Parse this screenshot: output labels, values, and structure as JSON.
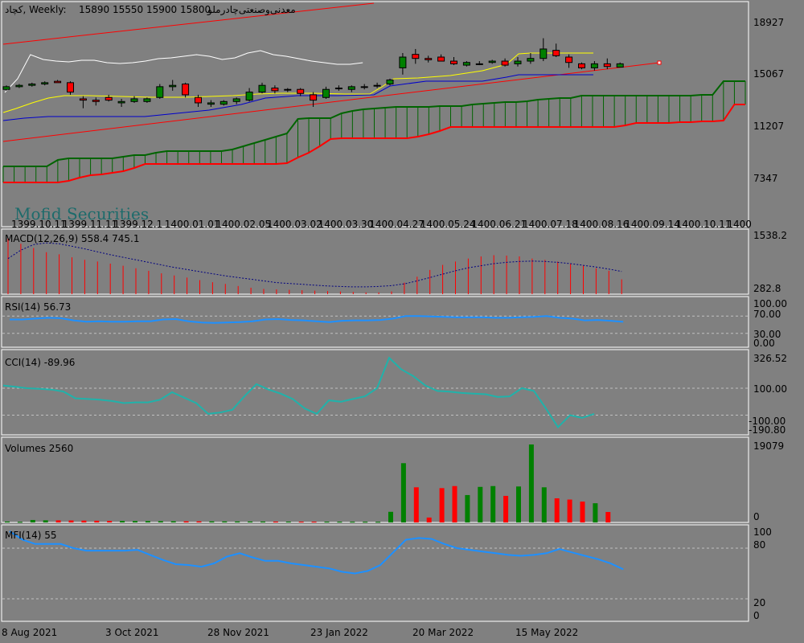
{
  "header": {
    "symbol": "کچاد, Weekly:",
    "ohlc": "15890 15550 15900 15800",
    "name": "معدنی‌وصنعتی‌چادرملو"
  },
  "watermark": "Mofid Securities",
  "colors": {
    "background": "#808080",
    "bull": "#008000",
    "bear": "#ff0000",
    "ichimoku_cloud": "#006400",
    "ichimoku_base": "#ff0000",
    "channel": "#ff0000",
    "chikou": "#ffffff",
    "tenkan": "#ffff00",
    "kijun": "#0000cc",
    "macd_hist": "#ff0000",
    "macd_signal": "#000080",
    "rsi": "#1e90ff",
    "cci": "#20b2aa",
    "mfi": "#1e90ff"
  },
  "main_axis": {
    "ticks": [
      "18927",
      "15067",
      "11207",
      "7347"
    ]
  },
  "date_ticks_top": [
    "1399.10.11",
    "1399.11.11",
    "1399.12.1",
    "1400.01.01",
    "1400.02.05",
    "1400.03.02",
    "1400.03.30",
    "1400.04.27",
    "1400.05.24",
    "1400.06.21",
    "1400.07.18",
    "1400.08.16",
    "1400.09.14",
    "1400.10.11",
    "1400"
  ],
  "bottom_dates": [
    "8 Aug 2021",
    "3 Oct 2021",
    "28 Nov 2021",
    "23 Jan 2022",
    "20 Mar 2022",
    "15 May 2022"
  ],
  "macd": {
    "title": "MACD(12,26,9) 558.4 745.1",
    "ticks": [
      "1538.2",
      "282.8"
    ]
  },
  "rsi": {
    "title": "RSI(14) 56.73",
    "ticks": [
      "100.00",
      "70.00",
      "30.00",
      "0.00"
    ]
  },
  "cci": {
    "title": "CCI(14) -89.96",
    "ticks": [
      "326.52",
      "100.00",
      "-100.00",
      "-190.80"
    ]
  },
  "volumes": {
    "title": "Volumes 2560",
    "ticks": [
      "19079",
      "0"
    ]
  },
  "mfi": {
    "title": "MFI(14) 55",
    "ticks": [
      "100",
      "80",
      "20",
      "0"
    ]
  },
  "chart_data": {
    "type": "candlestick",
    "candles": [
      [
        13900,
        14200,
        13800,
        14100
      ],
      [
        14100,
        14300,
        14000,
        14200
      ],
      [
        14200,
        14400,
        14100,
        14300
      ],
      [
        14300,
        14500,
        14200,
        14400
      ],
      [
        14500,
        14600,
        14400,
        14400
      ],
      [
        14400,
        14500,
        13500,
        13700
      ],
      [
        13200,
        13400,
        12500,
        13100
      ],
      [
        13100,
        13300,
        12700,
        13000
      ],
      [
        13300,
        13500,
        13000,
        13100
      ],
      [
        12900,
        13200,
        12600,
        13000
      ],
      [
        13000,
        13400,
        12900,
        13200
      ],
      [
        13000,
        13300,
        12900,
        13200
      ],
      [
        13300,
        14300,
        13200,
        14100
      ],
      [
        14100,
        14600,
        13800,
        14200
      ],
      [
        14300,
        14400,
        13300,
        13500
      ],
      [
        13300,
        13500,
        12600,
        12900
      ],
      [
        12800,
        13100,
        12600,
        12900
      ],
      [
        12800,
        13100,
        12700,
        13000
      ],
      [
        13000,
        13300,
        12800,
        13200
      ],
      [
        13100,
        14000,
        13000,
        13700
      ],
      [
        13700,
        14400,
        13600,
        14200
      ],
      [
        14000,
        14200,
        13600,
        13800
      ],
      [
        13900,
        14000,
        13700,
        13900
      ],
      [
        13900,
        14000,
        13400,
        13600
      ],
      [
        13500,
        13700,
        12600,
        13100
      ],
      [
        13300,
        14100,
        13200,
        13900
      ],
      [
        14000,
        14200,
        13800,
        14000
      ],
      [
        13900,
        14200,
        13700,
        14100
      ],
      [
        14100,
        14300,
        13900,
        14100
      ],
      [
        14200,
        14400,
        14000,
        14200
      ],
      [
        14300,
        14700,
        14200,
        14600
      ],
      [
        15500,
        16600,
        15000,
        16300
      ],
      [
        16500,
        16900,
        15800,
        16200
      ],
      [
        16200,
        16400,
        15900,
        16100
      ],
      [
        16300,
        16500,
        16000,
        16000
      ],
      [
        16000,
        16300,
        15700,
        15800
      ],
      [
        15700,
        16000,
        15600,
        15900
      ],
      [
        15800,
        16000,
        15700,
        15800
      ],
      [
        15900,
        16100,
        15800,
        16000
      ],
      [
        16000,
        16200,
        15600,
        15700
      ],
      [
        15800,
        16300,
        15600,
        16000
      ],
      [
        16000,
        16600,
        15800,
        16200
      ],
      [
        16200,
        17700,
        16000,
        16900
      ],
      [
        16800,
        17300,
        16300,
        16400
      ],
      [
        16300,
        16500,
        15500,
        15900
      ],
      [
        15800,
        15900,
        15400,
        15500
      ],
      [
        15500,
        16000,
        15300,
        15800
      ],
      [
        15800,
        16200,
        15400,
        15600
      ],
      [
        15550,
        15900,
        15550,
        15800
      ]
    ],
    "volumes": [
      220,
      150,
      600,
      520,
      510,
      480,
      450,
      420,
      390,
      360,
      340,
      330,
      310,
      290,
      280,
      270,
      260,
      250,
      240,
      230,
      220,
      210,
      200,
      195,
      190,
      185,
      180,
      175,
      170,
      165,
      2600,
      14500,
      8600,
      1200,
      8400,
      8900,
      6700,
      8700,
      8900,
      6500,
      8800,
      19079,
      8600,
      5900,
      5600,
      5100,
      4700,
      2560
    ],
    "macd_hist": [
      1538,
      1400,
      1300,
      1200,
      1150,
      1080,
      1020,
      980,
      930,
      880,
      820,
      760,
      700,
      650,
      600,
      540,
      490,
      450,
      400,
      360,
      330,
      320,
      310,
      300,
      290,
      280,
      270,
      260,
      250,
      250,
      270,
      480,
      620,
      780,
      900,
      980,
      1050,
      1100,
      1130,
      1120,
      1100,
      1050,
      1020,
      980,
      930,
      880,
      820,
      760,
      558
    ],
    "macd_signal": [
      1050,
      1250,
      1380,
      1420,
      1400,
      1340,
      1280,
      1210,
      1140,
      1080,
      1020,
      960,
      900,
      840,
      790,
      740,
      690,
      640,
      600,
      560,
      520,
      480,
      460,
      440,
      420,
      400,
      390,
      380,
      380,
      390,
      410,
      450,
      520,
      600,
      680,
      760,
      830,
      880,
      930,
      960,
      980,
      990,
      980,
      960,
      930,
      890,
      850,
      800,
      745
    ],
    "rsi": [
      62,
      62,
      64,
      66,
      65,
      60,
      57,
      58,
      57,
      57,
      58,
      58,
      62,
      63,
      58,
      55,
      54,
      55,
      56,
      58,
      62,
      63,
      61,
      60,
      58,
      56,
      59,
      60,
      60,
      61,
      64,
      70,
      70,
      69,
      68,
      67,
      67,
      67,
      66,
      66,
      67,
      68,
      70,
      66,
      64,
      60,
      61,
      59,
      56.73
    ],
    "cci": [
      120,
      110,
      100,
      95,
      90,
      75,
      25,
      20,
      15,
      5,
      -10,
      -5,
      -5,
      15,
      70,
      30,
      -10,
      -90,
      -80,
      -60,
      40,
      130,
      90,
      60,
      20,
      -50,
      -90,
      10,
      0,
      20,
      40,
      100,
      326,
      240,
      190,
      120,
      80,
      75,
      65,
      60,
      55,
      35,
      40,
      100,
      80,
      -50,
      -190,
      -100,
      -120,
      -90
    ],
    "mfi": [
      100,
      90,
      85,
      85,
      85,
      80,
      77,
      77,
      77,
      77,
      78,
      72,
      66,
      61,
      60,
      58,
      62,
      70,
      74,
      69,
      65,
      65,
      62,
      60,
      58,
      56,
      52,
      50,
      53,
      60,
      75,
      90,
      92,
      91,
      85,
      80,
      78,
      76,
      74,
      72,
      71,
      72,
      74,
      79,
      75,
      71,
      67,
      62,
      55
    ],
    "title": "",
    "xlabel": "",
    "ylabel": ""
  }
}
